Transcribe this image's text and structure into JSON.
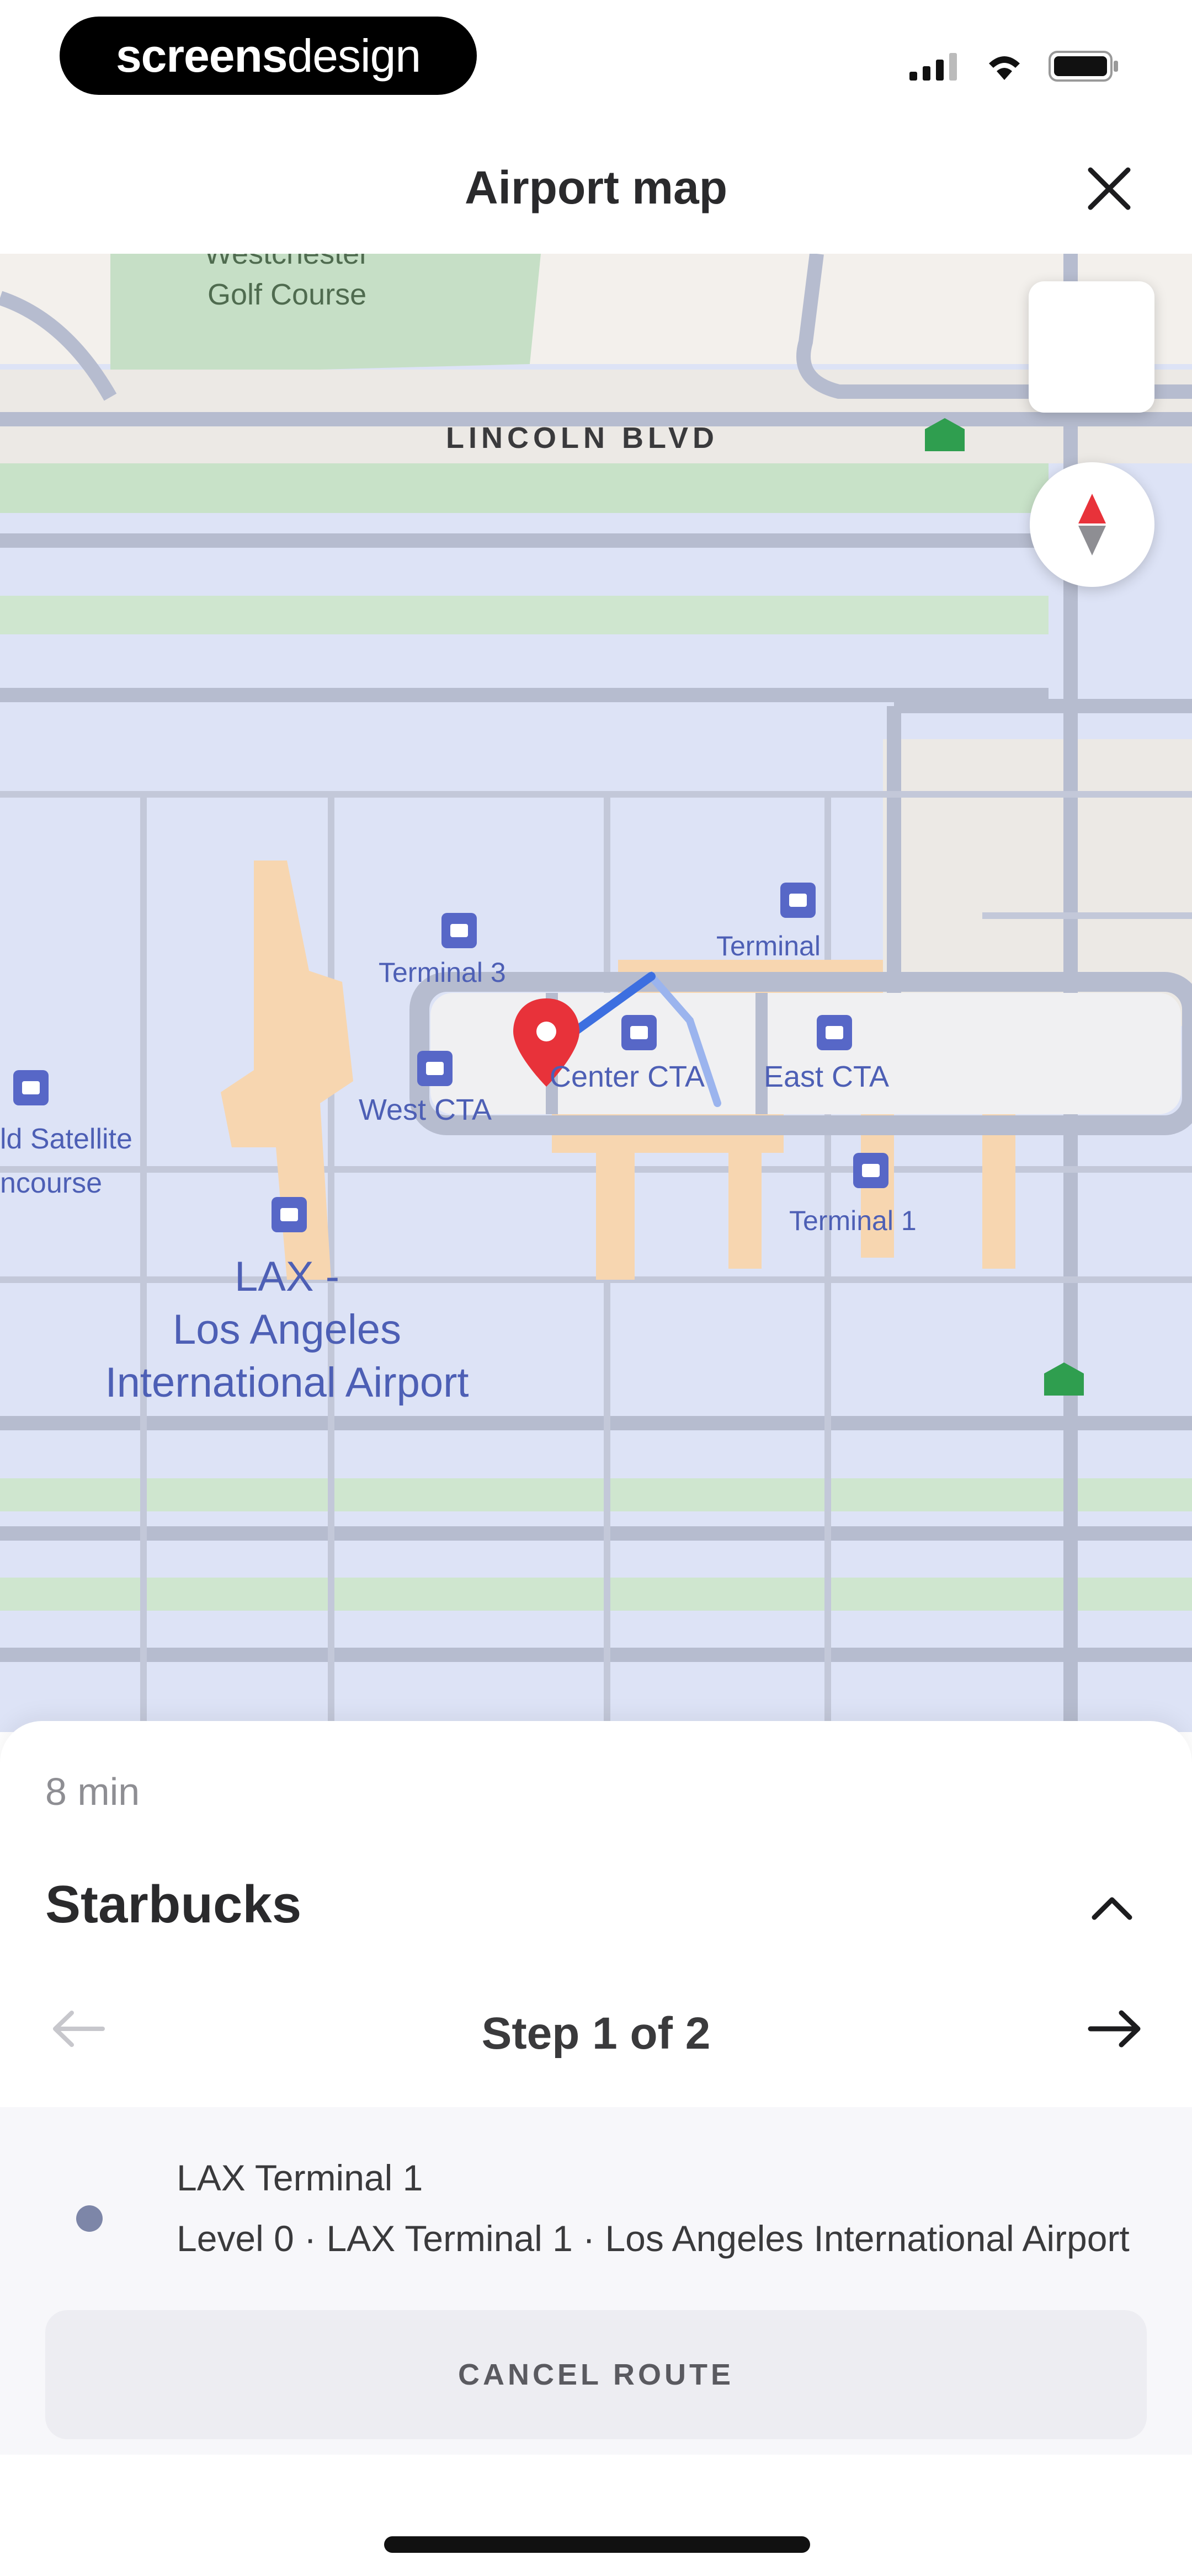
{
  "status_bar": {
    "brand_bold": "screens",
    "brand_light": "design",
    "icons": [
      "cellular-icon",
      "wifi-icon",
      "battery-icon"
    ]
  },
  "header": {
    "title": "Airport map",
    "close_icon": "close-icon"
  },
  "map": {
    "labels": {
      "golf_line1": "Westchester",
      "golf_line2": "Golf Course",
      "street": "LINCOLN BLVD",
      "terminal_3": "Terminal 3",
      "terminal_top": "Terminal",
      "west_cta": "West CTA",
      "center_cta": "Center CTA",
      "east_cta": "East CTA",
      "terminal_1": "Terminal 1",
      "satellite_line1": "ld Satellite",
      "satellite_line2": "ncourse",
      "airport_line1": "LAX -",
      "airport_line2": "Los Angeles",
      "airport_line3": "International Airport"
    },
    "colors": {
      "background": "#dde3f6",
      "green": "#c6dfc6",
      "terminal": "#f7d6b0",
      "road": "#b6bccf",
      "route": "#3d6fe0",
      "pin": "#e8323a",
      "label": "#4d5fb5",
      "exit_marker": "#2f9e4f"
    }
  },
  "sheet": {
    "eta": "8 min",
    "destination": "Starbucks",
    "step_label": "Step 1 of 2",
    "step": {
      "title": "LAX Terminal 1",
      "subtitle": "Level 0 · LAX Terminal 1 · Los Angeles International Airport"
    },
    "cancel_label": "CANCEL ROUTE"
  }
}
